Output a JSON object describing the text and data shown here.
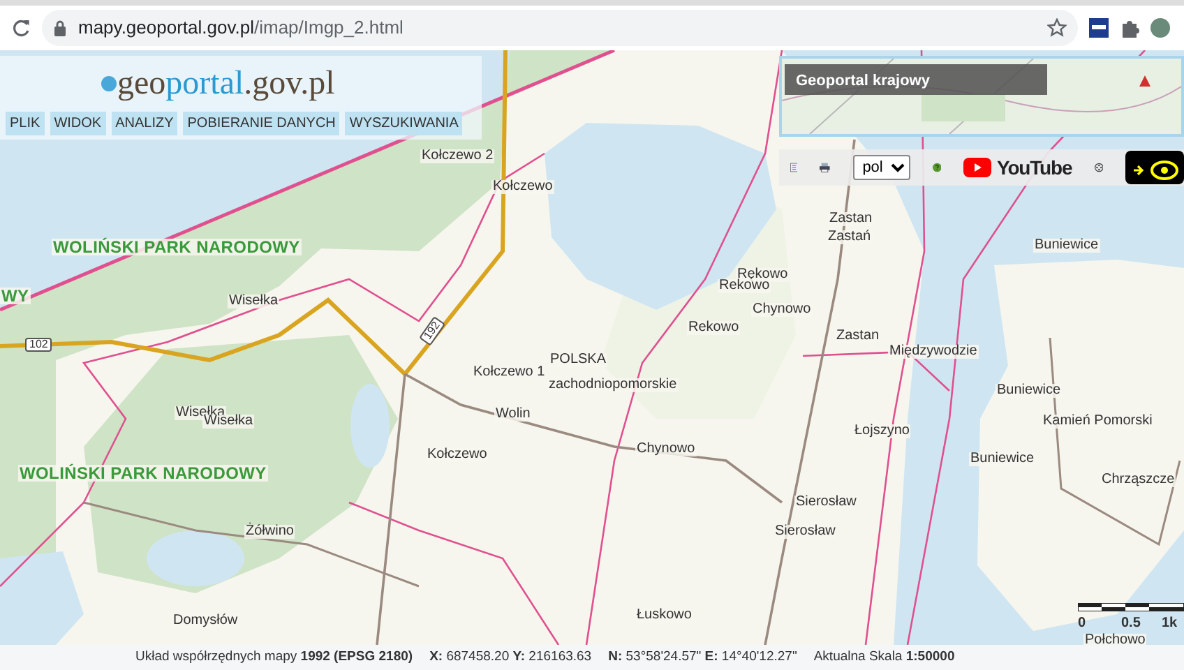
{
  "browser": {
    "url_domain": "mapy.geoportal.gov.pl",
    "url_path": "/imap/Imgp_2.html"
  },
  "app": {
    "logo": {
      "part_1": "geo",
      "part_2": "portal",
      "part_3": ".gov.pl"
    },
    "menu": [
      {
        "label": "PLIK"
      },
      {
        "label": "WIDOK"
      },
      {
        "label": "ANALIZY"
      },
      {
        "label": "POBIERANIE DANYCH"
      },
      {
        "label": "WYSZUKIWANIA"
      }
    ]
  },
  "overview_map": {
    "title": "Geoportal krajowy"
  },
  "toolbar": {
    "language": "pol",
    "youtube_label": "YouTube"
  },
  "map": {
    "labels": [
      {
        "text": "Kołczewo 2",
        "kind": "place"
      },
      {
        "text": "Kołczewo",
        "kind": "place"
      },
      {
        "text": "WOLIŃSKI PARK NARODOWY",
        "kind": "park"
      },
      {
        "text": "WY",
        "kind": "park"
      },
      {
        "text": "Wisełka",
        "kind": "place"
      },
      {
        "text": "102",
        "kind": "road"
      },
      {
        "text": "192",
        "kind": "road"
      },
      {
        "text": "Kołczewo 1",
        "kind": "place"
      },
      {
        "text": "POLSKA",
        "kind": "place"
      },
      {
        "text": "zachodniopomorskie",
        "kind": "place"
      },
      {
        "text": "Wolin",
        "kind": "place"
      },
      {
        "text": "Wisełka",
        "kind": "place"
      },
      {
        "text": "Wisełka",
        "kind": "place"
      },
      {
        "text": "Kołczewo",
        "kind": "place"
      },
      {
        "text": "WOLIŃSKI PARK NARODOWY",
        "kind": "park"
      },
      {
        "text": "Żółwino",
        "kind": "place"
      },
      {
        "text": "Domysłów",
        "kind": "place"
      },
      {
        "text": "Zastan",
        "kind": "place"
      },
      {
        "text": "Zastań",
        "kind": "place"
      },
      {
        "text": "Buniewice",
        "kind": "place"
      },
      {
        "text": "Rękowo",
        "kind": "place"
      },
      {
        "text": "Rekowo",
        "kind": "place"
      },
      {
        "text": "Chynowo",
        "kind": "place"
      },
      {
        "text": "Rekowo",
        "kind": "place"
      },
      {
        "text": "Zastan",
        "kind": "place"
      },
      {
        "text": "Międzywodzie",
        "kind": "place"
      },
      {
        "text": "Buniewice",
        "kind": "place"
      },
      {
        "text": "Kamień Pomorski",
        "kind": "place"
      },
      {
        "text": "Łojszyno",
        "kind": "place"
      },
      {
        "text": "Chynowo",
        "kind": "place"
      },
      {
        "text": "Buniewice",
        "kind": "place"
      },
      {
        "text": "Chrząszcze",
        "kind": "place"
      },
      {
        "text": "Sierosław",
        "kind": "place"
      },
      {
        "text": "Sierosław",
        "kind": "place"
      },
      {
        "text": "Łuskowo",
        "kind": "place"
      },
      {
        "text": "Połchowo",
        "kind": "place"
      }
    ],
    "scale_labels": [
      "0",
      "0.5",
      "1k"
    ]
  },
  "status_bar": [
    "Układ współrzędnych mapy **1992 (EPSG 2180)**",
    "**X:** 687458.20 **Y:** 216163.63",
    "**N:** 53°58'24.57\" **E:** 14°40'12.27\"",
    "Aktualna Skala **1:50000**"
  ]
}
